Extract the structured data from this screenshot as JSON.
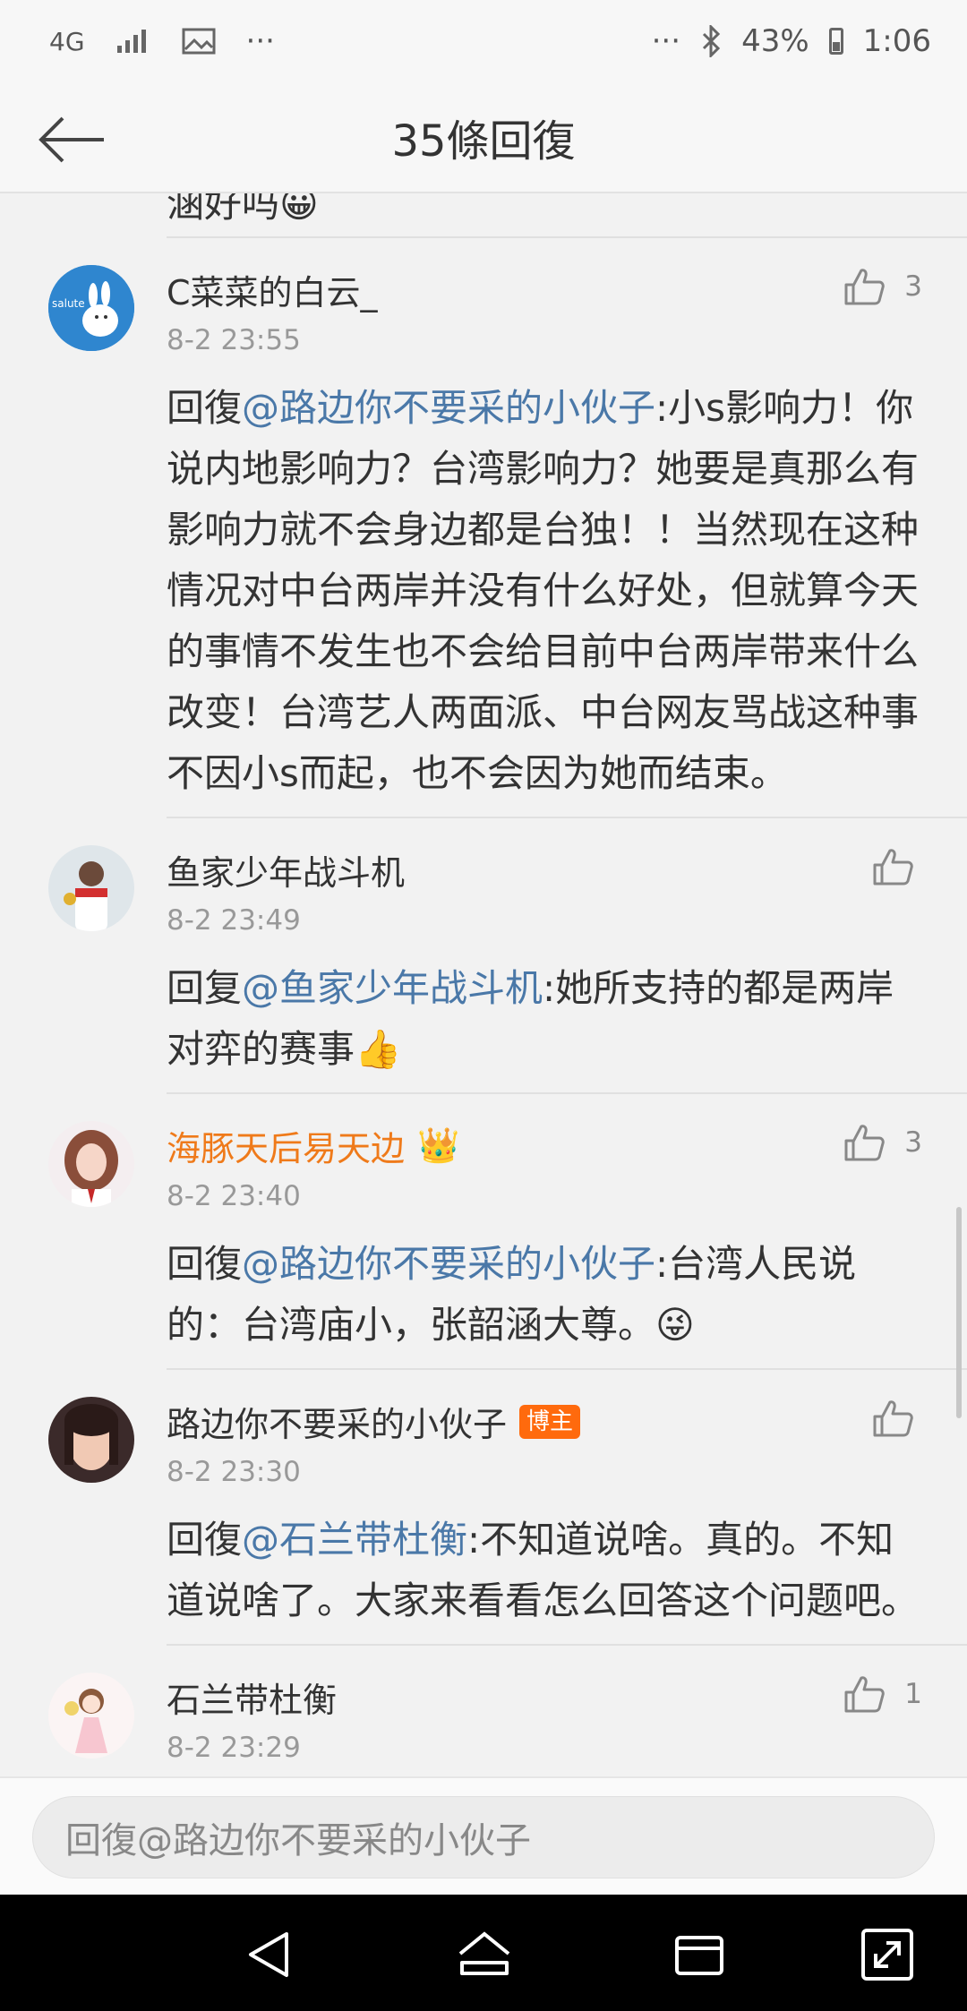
{
  "status_bar": {
    "network": "4G",
    "more_left": "···",
    "more_right": "···",
    "battery": "43%",
    "time": "1:06"
  },
  "header": {
    "title": "35條回復"
  },
  "previous_comment_tail": "涵好吗",
  "comments": [
    {
      "name": "C菜菜的白云_",
      "time": "8-2 23:55",
      "likes": "3",
      "reply_prefix": "回復",
      "mention": "@路边你不要采的小伙子",
      "text": ":小s影响力！你说内地影响力？台湾影响力？她要是真那么有影响力就不会身边都是台独！！当然现在这种情况对中台两岸并没有什么好处，但就算今天的事情不发生也不会给目前中台两岸带来什么改变！台湾艺人两面派、中台网友骂战这种事不因小s而起，也不会因为她而结束。",
      "avatar_text": "salute"
    },
    {
      "name": "鱼家少年战斗机",
      "time": "8-2 23:49",
      "likes": "",
      "reply_prefix": "回复",
      "mention": "@鱼家少年战斗机",
      "text": ":她所支持的都是两岸对弈的赛事",
      "emoji": "👍"
    },
    {
      "name": "海豚天后易天边",
      "time": "8-2 23:40",
      "likes": "3",
      "reply_prefix": "回復",
      "mention": "@路边你不要采的小伙子",
      "text": ":台湾人民说的：台湾庙小，张韶涵大尊。",
      "emoji": "😜"
    },
    {
      "name": "路边你不要采的小伙子",
      "badge": "博主",
      "time": "8-2 23:30",
      "likes": "",
      "reply_prefix": "回復",
      "mention": "@石兰带杜衡",
      "text": ":不知道说啥。真的。不知道说啥了。大家来看看怎么回答这个问题吧。"
    },
    {
      "name": "石兰带杜衡",
      "time": "8-2 23:29",
      "likes": "1"
    }
  ],
  "reply_input": {
    "placeholder": "回復@路边你不要采的小伙子"
  },
  "colors": {
    "mention": "#4a78a8",
    "vip_name": "#ef7a1a",
    "badge": "#ff6a0d"
  }
}
